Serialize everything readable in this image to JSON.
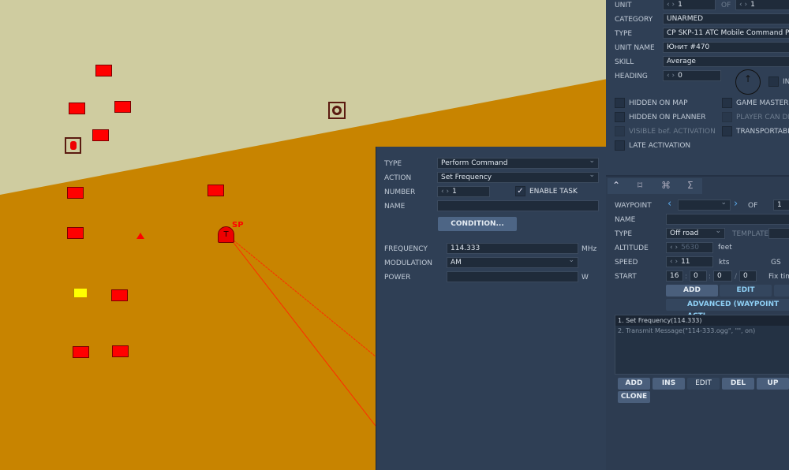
{
  "map": {
    "label_sp": "SP",
    "colors": {
      "terrain_light": "#cfcca0",
      "terrain_sand": "#c88400",
      "unit": "#ff0000"
    }
  },
  "task": {
    "type_label": "TYPE",
    "type_value": "Perform Command",
    "action_label": "ACTION",
    "action_value": "Set Frequency",
    "number_label": "NUMBER",
    "number_value": "1",
    "enable_task_label": "ENABLE TASK",
    "enable_task_checked": true,
    "name_label": "NAME",
    "name_value": "",
    "condition_button": "CONDITION...",
    "frequency_label": "FREQUENCY",
    "frequency_value": "114.333",
    "frequency_unit": "MHz",
    "modulation_label": "MODULATION",
    "modulation_value": "AM",
    "power_label": "POWER",
    "power_value": "",
    "power_unit": "W"
  },
  "unit": {
    "unit_label": "UNIT",
    "unit_value": "1",
    "of_label": "OF",
    "of_value": "1",
    "category_label": "CATEGORY",
    "category_value": "UNARMED",
    "type_label": "TYPE",
    "type_value": "CP SKP-11 ATC Mobile Command Pos",
    "unit_name_label": "UNIT NAME",
    "unit_name_value": "Юнит #470",
    "skill_label": "SKILL",
    "skill_value": "Average",
    "heading_label": "HEADING",
    "heading_value": "0",
    "in_label": "IN",
    "checkboxes": [
      {
        "label": "HIDDEN ON MAP",
        "enabled": true
      },
      {
        "label": "HIDDEN ON PLANNER",
        "enabled": true
      },
      {
        "label": "VISIBLE bef. ACTIVATION",
        "enabled": false
      },
      {
        "label": "LATE ACTIVATION",
        "enabled": true
      },
      {
        "label": "GAME MASTER",
        "enabled": true
      },
      {
        "label": "PLAYER CAN DR",
        "enabled": false
      },
      {
        "label": "TRANSPORTABL",
        "enabled": true
      }
    ]
  },
  "route": {
    "tabs": [
      {
        "icon": "route-icon"
      },
      {
        "icon": "target-icon"
      },
      {
        "icon": "waypoint-actions-icon"
      },
      {
        "icon": "summary-icon"
      }
    ],
    "tab_glyphs": [
      "⌃",
      "⌑",
      "⌘",
      "Σ"
    ],
    "waypoint_label": "WAYPOINT",
    "waypoint_value": "",
    "of_label": "OF",
    "of_value": "1",
    "name_label": "NAME",
    "name_value": "",
    "type_label": "TYPE",
    "type_value": "Off road",
    "template_label": "TEMPLATE",
    "altitude_label": "ALTITUDE",
    "altitude_value": "5630",
    "altitude_unit": "feet",
    "speed_label": "SPEED",
    "speed_value": "11",
    "speed_unit": "kts",
    "gs_label": "GS",
    "start_label": "START",
    "start_h": "16",
    "start_m": "0",
    "start_s": "0",
    "start_d": "0",
    "fix_time_label": "Fix tim",
    "add_button": "ADD",
    "edit_button": "EDIT",
    "advanced_button": "ADVANCED (WAYPOINT ACTI",
    "actions": [
      "1. Set Frequency(114.333)",
      "2. Transmit Message(\"114-333.ogg\", \"\", on)"
    ],
    "buttons": [
      "ADD",
      "INS",
      "EDIT",
      "DEL",
      "UP",
      "CLONE"
    ]
  }
}
